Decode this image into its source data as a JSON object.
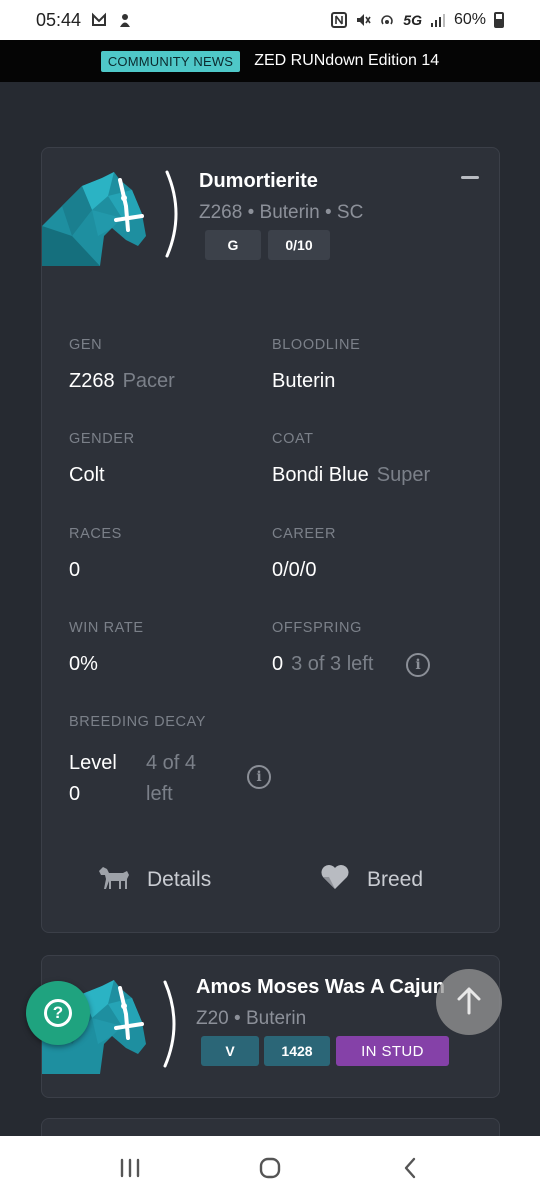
{
  "status_bar": {
    "time": "05:44",
    "network": "5G",
    "battery": "60%"
  },
  "news": {
    "badge": "COMMUNITY NEWS",
    "text": "ZED RUNdown Edition 14"
  },
  "horses": [
    {
      "name": "Dumortierite",
      "subtitle": "Z268 • Buterin • SC",
      "pills": [
        "G",
        "0/10"
      ],
      "stats": {
        "gen": {
          "label": "GEN",
          "value": "Z268",
          "extra": "Pacer"
        },
        "bloodline": {
          "label": "BLOODLINE",
          "value": "Buterin"
        },
        "gender": {
          "label": "GENDER",
          "value": "Colt"
        },
        "coat": {
          "label": "COAT",
          "value": "Bondi Blue",
          "extra": "Super"
        },
        "races": {
          "label": "RACES",
          "value": "0"
        },
        "career": {
          "label": "CAREER",
          "value": "0/0/0"
        },
        "win_rate": {
          "label": "WIN RATE",
          "value": "0%"
        },
        "offspring": {
          "label": "OFFSPRING",
          "value": "0",
          "extra": "3 of 3 left"
        },
        "breeding_decay": {
          "label": "BREEDING DECAY",
          "value_line1": "Level",
          "value_line2": "0",
          "extra_line1": "4 of 4",
          "extra_line2": "left"
        }
      },
      "actions": {
        "details": "Details",
        "breed": "Breed"
      }
    },
    {
      "name": "Amos Moses Was A Cajun",
      "subtitle": "Z20 • Buterin",
      "pills": [
        "V",
        "1428",
        "IN STUD"
      ]
    }
  ],
  "icons": {
    "horse_image": "horse-head-icon",
    "help": "help-icon",
    "scroll_top": "arrow-up-icon"
  },
  "colors": {
    "background": "#262a31",
    "card": "#2d3139",
    "accent_teal": "#4fc8c8",
    "help_green": "#1fa37f",
    "stud_purple": "#8541a8"
  }
}
